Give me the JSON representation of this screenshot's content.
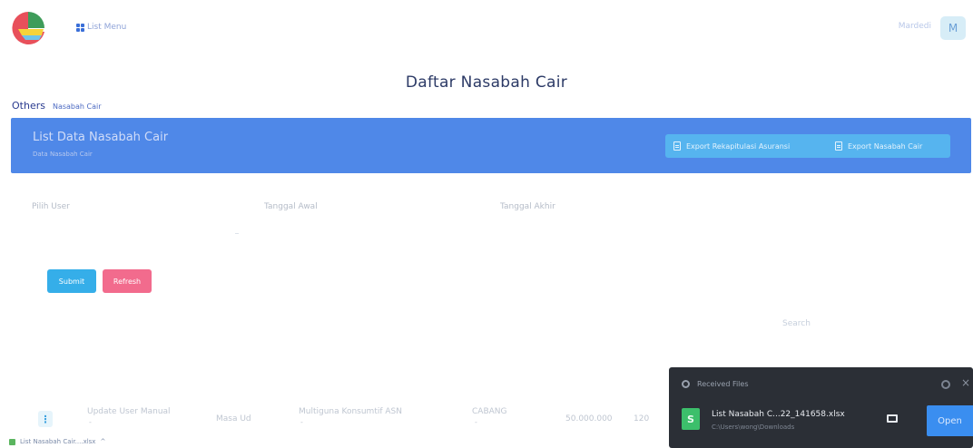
{
  "topbar": {
    "menu_label": "List Menu",
    "user_name": "Mardedi",
    "avatar_letter": "M"
  },
  "page": {
    "title": "Daftar Nasabah Cair"
  },
  "breadcrumb": {
    "root": "Others",
    "current": "Nasabah Cair"
  },
  "card": {
    "title": "List Data Nasabah Cair",
    "subtitle": "Data Nasabah Cair",
    "export_rekap_label": "Export Rekapitulasi Asuransi",
    "export_nasabah_label": "Export Nasabah Cair"
  },
  "filter": {
    "label_user": "Pilih User",
    "label_start": "Tanggal Awal",
    "label_end": "Tanggal Akhir",
    "submit_label": "Submit",
    "refresh_label": "Refresh"
  },
  "search": {
    "label": "Search"
  },
  "table": {
    "rows": [
      {
        "action": "⋮",
        "status": "Update User Manual",
        "status_sub": "-",
        "kode": "Masa Ud",
        "produk": "Multiguna Konsumtif ASN",
        "produk_sub": "-",
        "unit": "CABANG",
        "unit_sub": "-",
        "plafond": "50.000.000",
        "tenor": "120"
      }
    ]
  },
  "download_bar": {
    "file_label": "List Nasabah Cair....xlsx",
    "chevron": "^"
  },
  "popup": {
    "title": "Received Files",
    "close": "×",
    "file_icon_letter": "S",
    "file_name": "List Nasabah C...22_141658.xlsx",
    "file_path": "C:\\Users\\wong\\Downloads",
    "open_label": "Open"
  },
  "colors": {
    "header_blue": "#4f88e8",
    "submit": "#35aee9",
    "refresh": "#f26b8d",
    "open": "#3a8ef0"
  }
}
